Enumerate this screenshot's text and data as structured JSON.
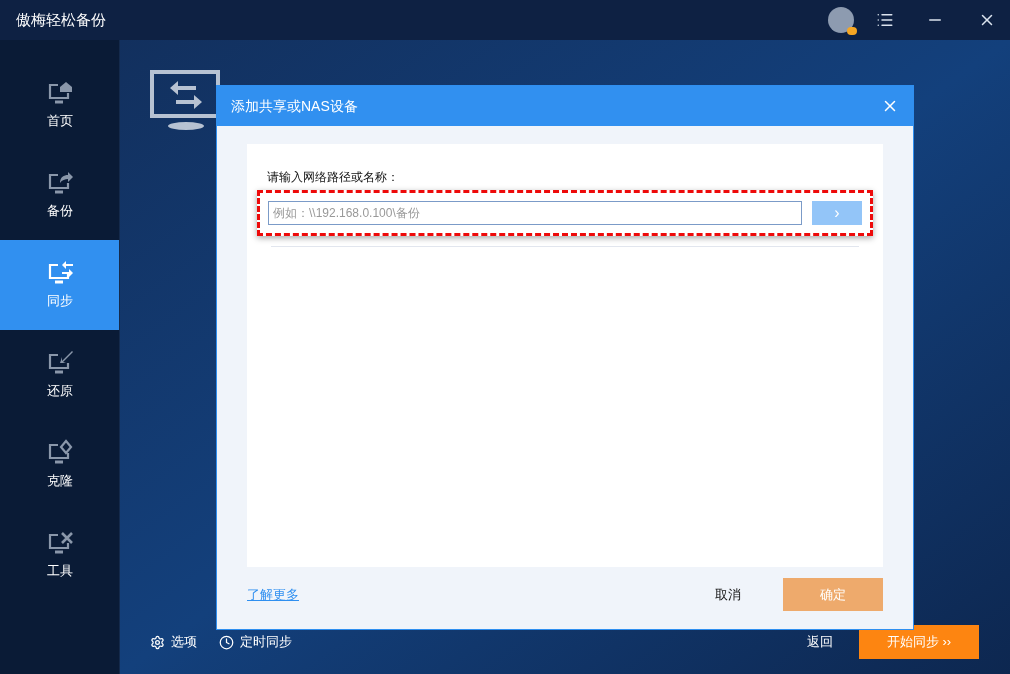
{
  "app": {
    "title": "傲梅轻松备份"
  },
  "sidebar": {
    "items": [
      {
        "label": "首页",
        "kind": "home",
        "selected": false
      },
      {
        "label": "备份",
        "kind": "backup",
        "selected": false
      },
      {
        "label": "同步",
        "kind": "sync",
        "selected": true
      },
      {
        "label": "还原",
        "kind": "restore",
        "selected": false
      },
      {
        "label": "克隆",
        "kind": "clone",
        "selected": false
      },
      {
        "label": "工具",
        "kind": "tools",
        "selected": false
      }
    ]
  },
  "bottom_bar": {
    "options": "选项",
    "schedule": "定时同步",
    "back": "返回",
    "start": "开始同步 ››"
  },
  "dialog": {
    "title": "添加共享或NAS设备",
    "field_label": "请输入网络路径或名称：",
    "placeholder": "例如：\\\\192.168.0.100\\备份",
    "go_button": "›",
    "learn_more": "了解更多",
    "cancel": "取消",
    "ok": "确定",
    "ok_disabled": true
  }
}
